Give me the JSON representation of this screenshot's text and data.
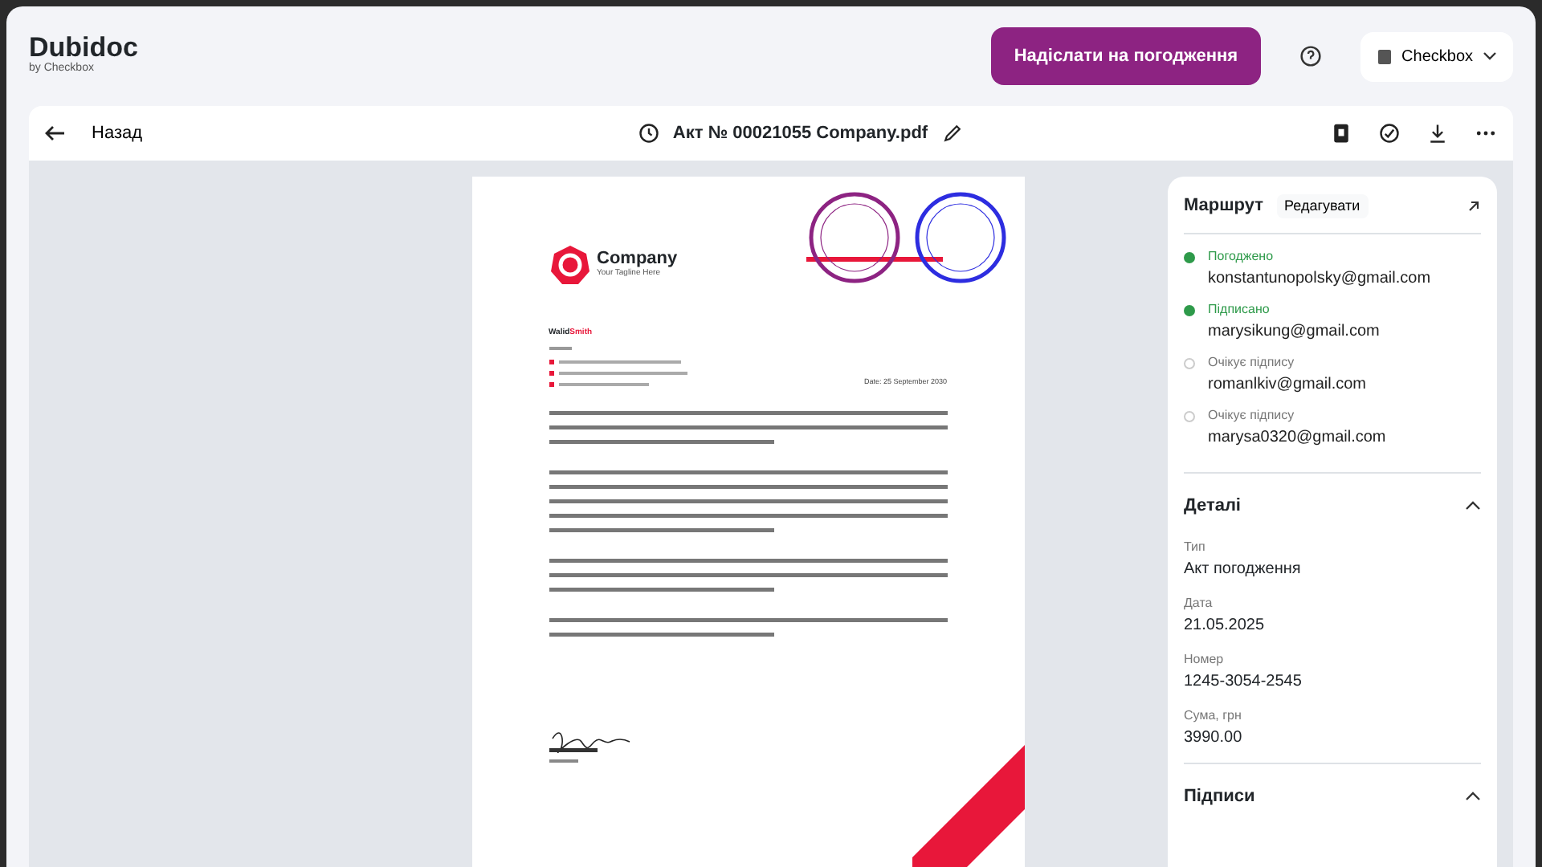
{
  "brand": {
    "name": "Dubidoc",
    "tagline": "by Checkbox"
  },
  "header": {
    "send_button": "Надіслати на погодження",
    "account": "Checkbox"
  },
  "toolbar": {
    "back": "Назад",
    "file_name": "Акт № 00021055 Company.pdf"
  },
  "document": {
    "company": "Company",
    "tagline": "Your Tagline Here",
    "sender_first": "Walid",
    "sender_last": "Smith",
    "date": "Date: 25 September 2030"
  },
  "route": {
    "title": "Маршрут",
    "edit": "Редагувати",
    "steps": [
      {
        "status": "Погоджено",
        "email": "konstantunopolsky@gmail.com",
        "done": true
      },
      {
        "status": "Підписано",
        "email": "marysikung@gmail.com",
        "done": true
      },
      {
        "status": "Очікує підпису",
        "email": "romanlkiv@gmail.com",
        "done": false
      },
      {
        "status": "Очікує підпису",
        "email": "marysa0320@gmail.com",
        "done": false
      }
    ]
  },
  "details": {
    "title": "Деталі",
    "expanded": true,
    "fields": [
      {
        "label": "Тип",
        "value": "Акт погодження"
      },
      {
        "label": "Дата",
        "value": "21.05.2025"
      },
      {
        "label": "Номер",
        "value": "1245-3054-2545"
      },
      {
        "label": "Сума, грн",
        "value": "3990.00"
      }
    ]
  },
  "signatures": {
    "title": "Підписи",
    "expanded": true
  }
}
